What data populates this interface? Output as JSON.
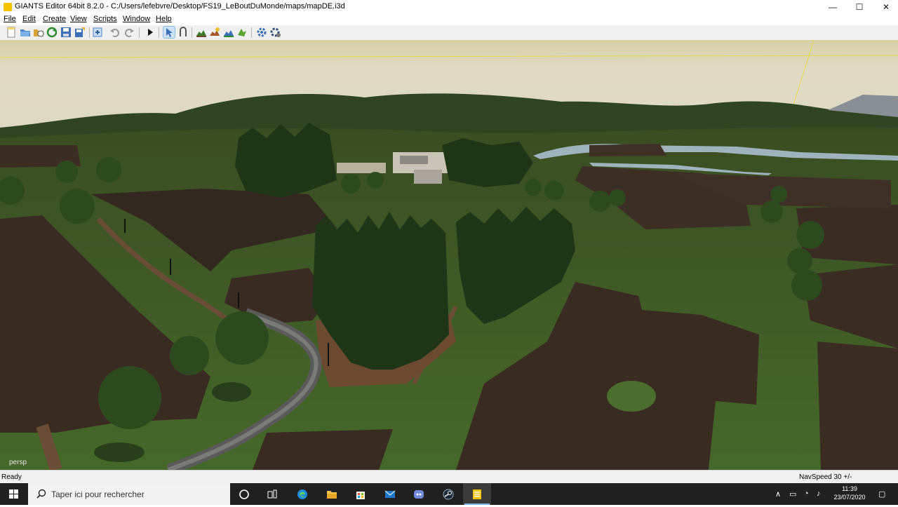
{
  "window": {
    "title": "GIANTS Editor 64bit 8.2.0 - C:/Users/lefebvre/Desktop/FS19_LeBoutDuMonde/maps/mapDE.i3d",
    "minimize_glyph": "—",
    "maximize_glyph": "☐",
    "close_glyph": "✕"
  },
  "menu": {
    "items": [
      "File",
      "Edit",
      "Create",
      "View",
      "Scripts",
      "Window",
      "Help"
    ]
  },
  "toolbar": {
    "icons": [
      "new-file-icon",
      "open-folder-icon",
      "open-recent-icon",
      "reload-icon",
      "save-icon",
      "save-as-icon",
      "import-icon",
      "undo-icon",
      "redo-icon",
      "play-icon",
      "select-mode-icon",
      "move-mode-icon",
      "terrain-icon",
      "paint-icon",
      "foliage-icon",
      "shape-icon",
      "settings-gear-icon",
      "camera-settings-icon"
    ]
  },
  "viewport": {
    "camera_label": "persp"
  },
  "statusbar": {
    "status": "Ready",
    "navspeed": "NavSpeed 30 +/-"
  },
  "taskbar": {
    "search_placeholder": "Taper ici pour rechercher",
    "time": "11:39",
    "date": "23/07/2020",
    "apps": [
      "cortana-icon",
      "task-view-icon",
      "edge-icon",
      "file-explorer-icon",
      "store-icon",
      "mail-icon",
      "discord-icon",
      "steam-icon",
      "giants-editor-icon"
    ]
  },
  "colors": {
    "accent": "#f5c400",
    "sky": "#ddd8c4",
    "grass": "#3c5a22",
    "field": "#3a2c22",
    "taskbar": "#202020"
  }
}
